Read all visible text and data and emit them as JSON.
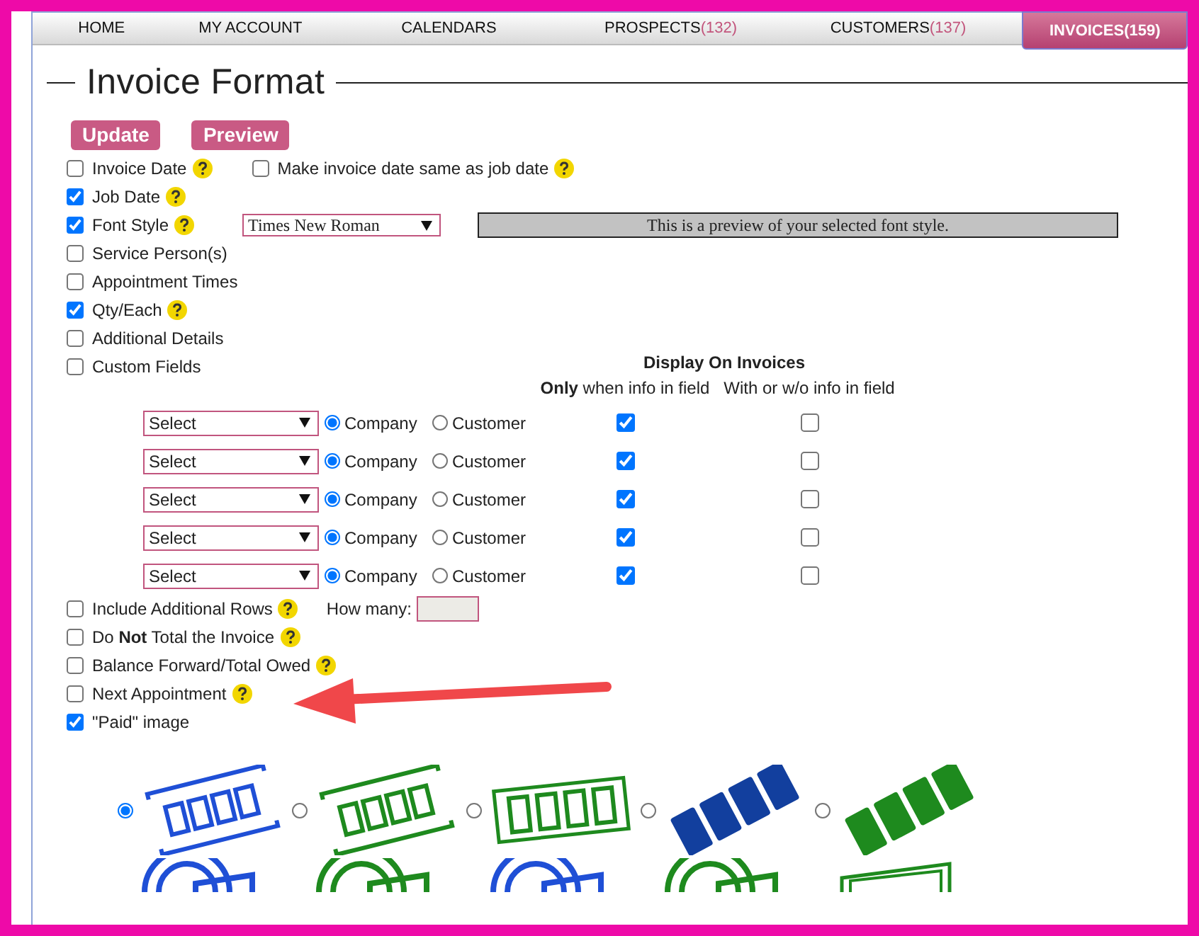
{
  "nav": {
    "tabs": [
      {
        "label": "HOME",
        "selected": false
      },
      {
        "label": "MY ACCOUNT",
        "selected": false
      },
      {
        "label": "CALENDARS",
        "selected": false
      },
      {
        "label": "PROSPECTS",
        "count": "(132)",
        "selected": false
      },
      {
        "label": "CUSTOMERS",
        "count": "(137)",
        "selected": false
      },
      {
        "label": "INVOICES",
        "count": "(159)",
        "selected": true
      }
    ]
  },
  "title": "Invoice Format",
  "buttons": [
    "Update",
    "Preview"
  ],
  "options": [
    {
      "kind": "pair",
      "label": "Invoice Date",
      "checked": false,
      "help": true,
      "second": {
        "label": "Make invoice date same as job date",
        "checked": false,
        "help": true
      }
    },
    {
      "kind": "plain",
      "label": "Job Date",
      "checked": true,
      "help": true
    },
    {
      "kind": "font",
      "label": "Font Style",
      "checked": true,
      "help": true,
      "font": "Times New Roman",
      "preview": "This is a preview of your selected font style."
    },
    {
      "kind": "plain",
      "label": "Service Person(s)",
      "checked": false,
      "help": false
    },
    {
      "kind": "plain",
      "label": "Appointment Times",
      "checked": false,
      "help": false
    },
    {
      "kind": "plain",
      "label": "Qty/Each",
      "checked": true,
      "help": true
    },
    {
      "kind": "plain",
      "label": "Additional Details",
      "checked": false,
      "help": false
    },
    {
      "kind": "custom",
      "label": "Custom Fields",
      "checked": false,
      "help": false,
      "table": {
        "heading": "Display On Invoices",
        "columns": [
          "**Only** when info in field",
          "With or w/o info in field"
        ],
        "rows": [
          {
            "select": "Select",
            "choices": [
              {
                "label": "Company",
                "selected": true
              },
              {
                "label": "Customer",
                "selected": false
              }
            ],
            "only_when": true,
            "always": false
          },
          {
            "select": "Select",
            "choices": [
              {
                "label": "Company",
                "selected": true
              },
              {
                "label": "Customer",
                "selected": false
              }
            ],
            "only_when": true,
            "always": false
          },
          {
            "select": "Select",
            "choices": [
              {
                "label": "Company",
                "selected": true
              },
              {
                "label": "Customer",
                "selected": false
              }
            ],
            "only_when": true,
            "always": false
          },
          {
            "select": "Select",
            "choices": [
              {
                "label": "Company",
                "selected": true
              },
              {
                "label": "Customer",
                "selected": false
              }
            ],
            "only_when": true,
            "always": false
          },
          {
            "select": "Select",
            "choices": [
              {
                "label": "Company",
                "selected": true
              },
              {
                "label": "Customer",
                "selected": false
              }
            ],
            "only_when": true,
            "always": false
          }
        ]
      }
    },
    {
      "kind": "rows",
      "label": "Include Additional Rows",
      "checked": false,
      "help": true,
      "how_many": "How many:"
    },
    {
      "kind": "plain",
      "label": "Do **Not** Total the Invoice",
      "checked": false,
      "help": true
    },
    {
      "kind": "plain",
      "label": "Balance Forward/Total Owed",
      "checked": false,
      "help": true
    },
    {
      "kind": "plain",
      "label": "Next Appointment",
      "checked": false,
      "help": true
    },
    {
      "kind": "plain",
      "label": "\"Paid\" image",
      "checked": true,
      "help": false
    }
  ],
  "paid_images": [
    {
      "kind": "frame",
      "color": "#1f4fd6",
      "selected": true
    },
    {
      "kind": "frame",
      "color": "#1e8a1e",
      "selected": false
    },
    {
      "kind": "box",
      "color": "#1e8a1e",
      "selected": false
    },
    {
      "kind": "bold",
      "color": "#123f9e",
      "selected": false
    },
    {
      "kind": "bold",
      "color": "#1e8a1e",
      "selected": false
    }
  ],
  "more_images": [
    {
      "kind": "round",
      "color": "#1f4fd6"
    },
    {
      "kind": "round",
      "color": "#1e8a1e"
    },
    {
      "kind": "round",
      "color": "#1f4fd6"
    },
    {
      "kind": "round",
      "color": "#1e8a1e"
    },
    {
      "kind": "flat",
      "color": "#1e8a1e"
    }
  ]
}
